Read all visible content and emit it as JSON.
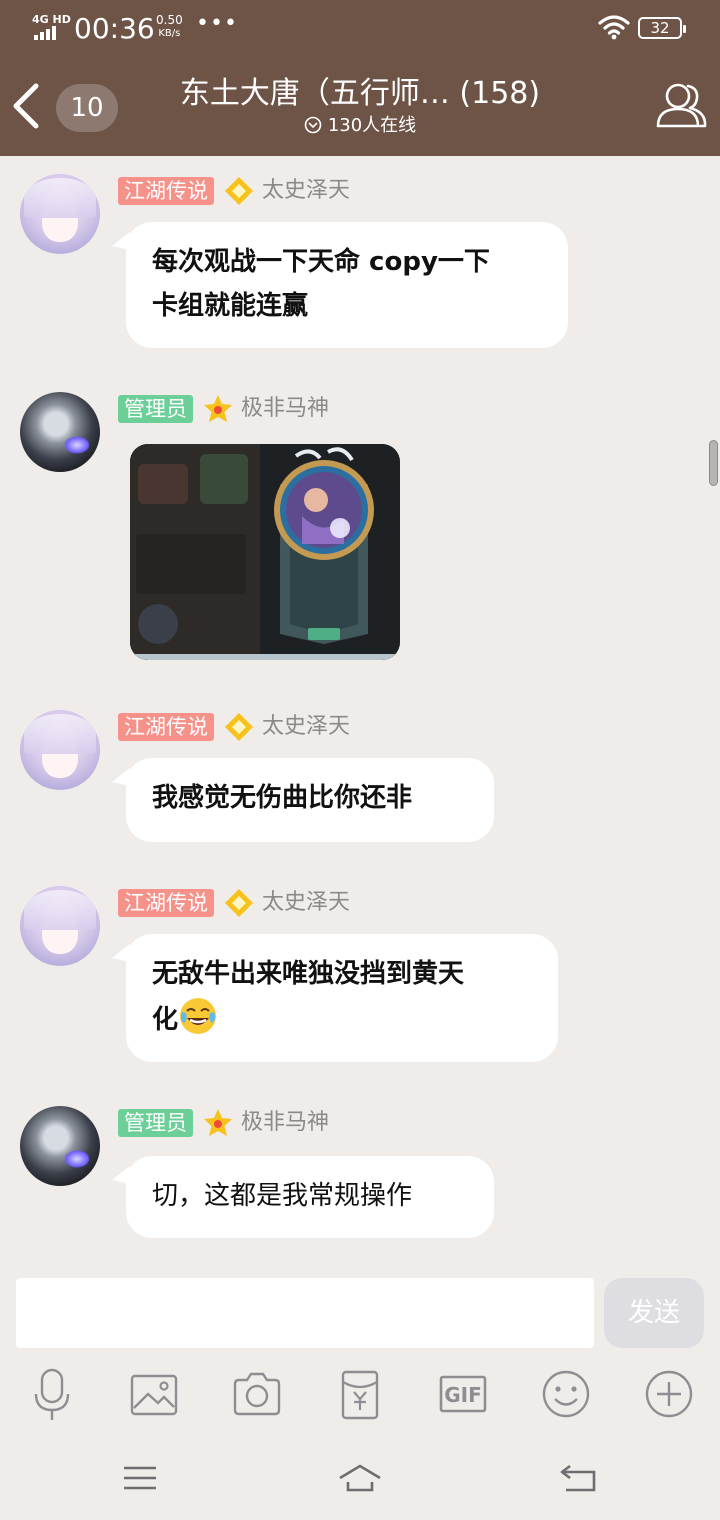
{
  "status_bar": {
    "network": "4G HD",
    "time": "00:36",
    "speed_value": "0.50",
    "speed_unit": "KB/s",
    "more": "•••",
    "battery": "32"
  },
  "header": {
    "unread_count": "10",
    "title": "东土大唐（五行师… (158)",
    "online_text": "130人在线"
  },
  "messages": [
    {
      "tag": "江湖传说",
      "tag_type": "legend",
      "nickname": "太史泽天",
      "avatar": "girl-avatar",
      "text": "每次观战一下天命 copy一下卡组就能连赢",
      "line1": "每次观战一下天命 copy一下",
      "line2": "卡组就能连赢"
    },
    {
      "tag": "管理员",
      "tag_type": "admin",
      "nickname": "极非马神",
      "avatar": "knight-avatar",
      "image": "game-screenshot"
    },
    {
      "tag": "江湖传说",
      "tag_type": "legend",
      "nickname": "太史泽天",
      "avatar": "girl-avatar",
      "text": "我感觉无伤曲比你还非"
    },
    {
      "tag": "江湖传说",
      "tag_type": "legend",
      "nickname": "太史泽天",
      "avatar": "girl-avatar",
      "line1": "无敌牛出来唯独没挡到黄天",
      "line2": "化",
      "emoji": "tears-of-joy-emoji"
    },
    {
      "tag": "管理员",
      "tag_type": "admin",
      "nickname": "极非马神",
      "avatar": "knight-avatar",
      "text": "切，这都是我常规操作"
    }
  ],
  "input": {
    "placeholder": "",
    "send_label": "发送"
  },
  "toolbar_icons": [
    "microphone-icon",
    "image-icon",
    "camera-icon",
    "red-packet-icon",
    "gif-icon",
    "emoji-icon",
    "plus-icon"
  ],
  "colors": {
    "header_bg": "#6e5447",
    "page_bg": "#f0ecea",
    "legend_tag": "#f6928a",
    "admin_tag": "#6dcf98",
    "send_disabled": "#dedee2"
  }
}
